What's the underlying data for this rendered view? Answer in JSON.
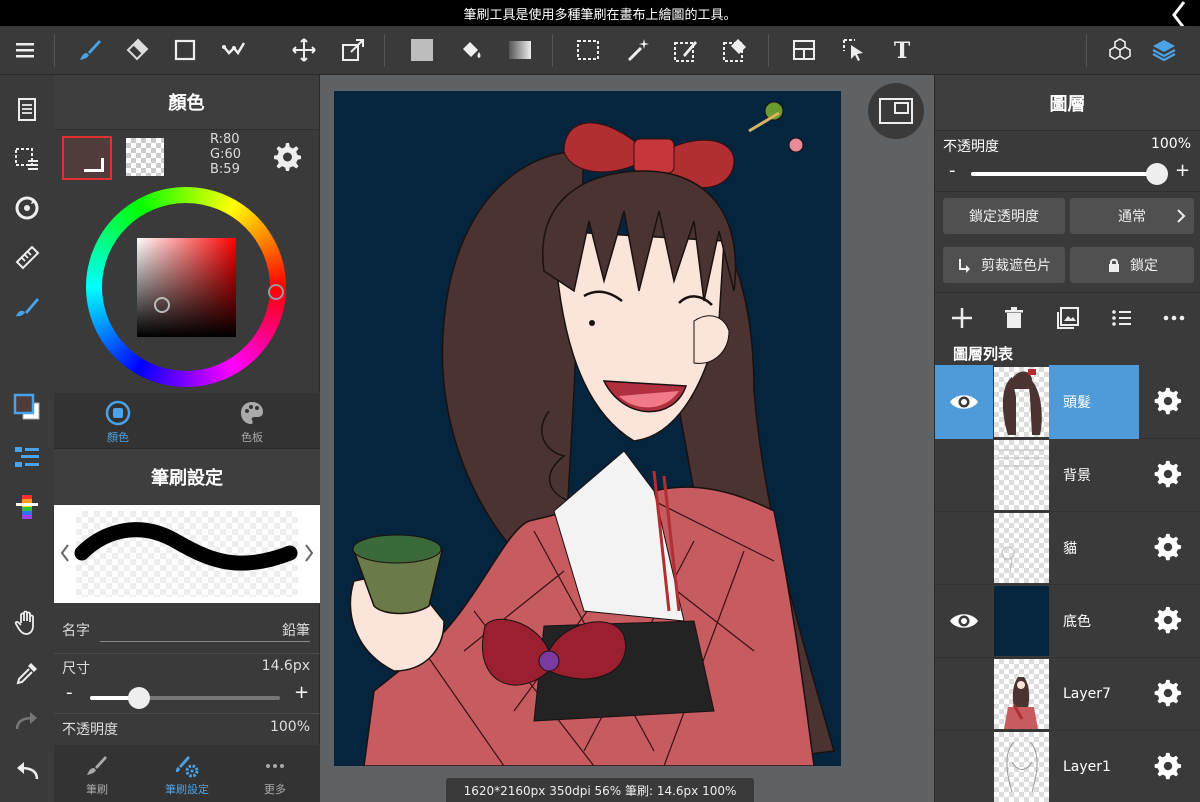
{
  "tooltip": "筆刷工具是使用多種筆刷在畫布上繪圖的工具。",
  "toolbar": {
    "tools": [
      "menu-icon",
      "brush-icon",
      "eraser-icon",
      "rect-shape-icon",
      "pen-correction-icon",
      "move-icon",
      "transform-icon",
      "fill-color-icon",
      "bucket-icon",
      "gradient-icon",
      "select-rect-icon",
      "magic-wand-icon",
      "select-pen-icon",
      "select-eraser-icon",
      "frame-icon",
      "operation-icon",
      "text-icon",
      "material-icon",
      "layers-icon"
    ],
    "active": "brush-icon"
  },
  "colors": {
    "accent": "#4f9ad9",
    "current_color": "#503c3b",
    "canvas_bg": "#05243e"
  },
  "color_panel": {
    "title": "顏色",
    "r_label": "R:80",
    "g_label": "G:60",
    "b_label": "B:59",
    "tabs": [
      {
        "label": "顏色",
        "active": true
      },
      {
        "label": "色板",
        "active": false
      }
    ]
  },
  "brush_panel": {
    "title": "筆刷設定",
    "name_label": "名字",
    "name_value": "鉛筆",
    "size_label": "尺寸",
    "size_value": "14.6px",
    "size_level": 0.26,
    "opacity_label": "不透明度",
    "opacity_value": "100%",
    "tabs": [
      {
        "label": "筆刷",
        "active": false
      },
      {
        "label": "筆刷設定",
        "active": true
      },
      {
        "label": "更多",
        "active": false
      }
    ]
  },
  "status_bar": "1620*2160px 350dpi 56% 筆刷: 14.6px 100%",
  "layers_panel": {
    "title": "圖層",
    "opacity_label": "不透明度",
    "opacity_value": "100%",
    "opacity_level": 1.0,
    "lock_alpha_label": "鎖定透明度",
    "blend_label": "通常",
    "clipping_label": "剪裁遮色片",
    "lock_label": "鎖定",
    "list_title": "圖層列表",
    "layers": [
      {
        "name": "頭髮",
        "visible": true,
        "selected": true
      },
      {
        "name": "背景",
        "visible": false,
        "selected": false
      },
      {
        "name": "貓",
        "visible": false,
        "selected": false
      },
      {
        "name": "底色",
        "visible": true,
        "selected": false
      },
      {
        "name": "Layer7",
        "visible": false,
        "selected": false
      },
      {
        "name": "Layer1",
        "visible": false,
        "selected": false
      }
    ]
  }
}
